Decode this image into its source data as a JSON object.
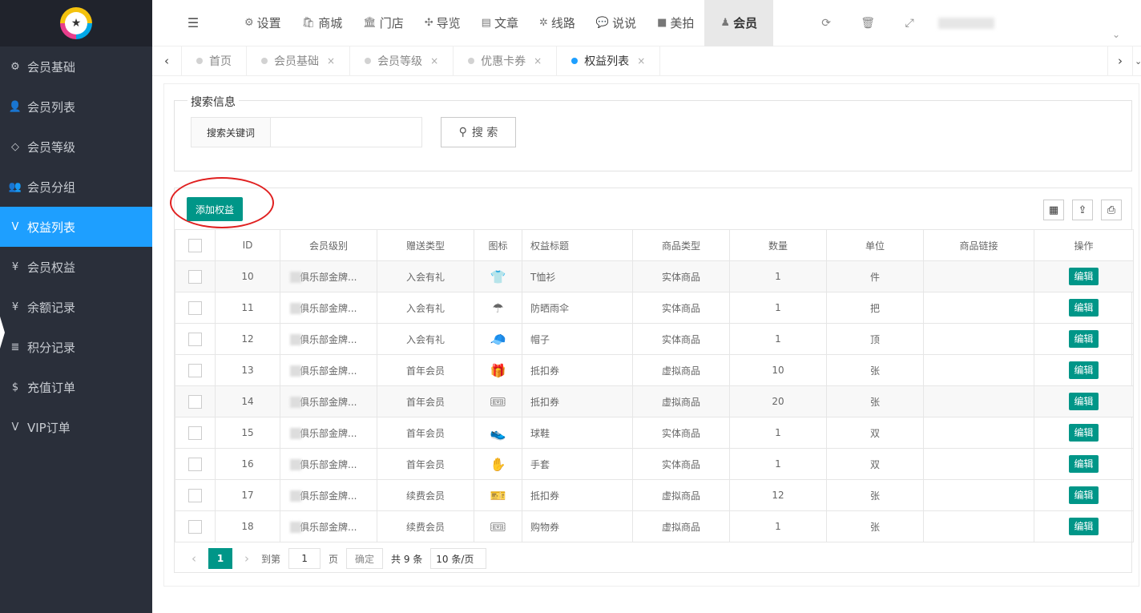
{
  "sidebar": {
    "items": [
      {
        "label": "会员基础",
        "icon": "gears-icon",
        "glyph": "⚙"
      },
      {
        "label": "会员列表",
        "icon": "user-icon",
        "glyph": "👤"
      },
      {
        "label": "会员等级",
        "icon": "diamond-icon",
        "glyph": "◇"
      },
      {
        "label": "会员分组",
        "icon": "users-icon",
        "glyph": "👥"
      },
      {
        "label": "权益列表",
        "icon": "vimeo-icon",
        "glyph": "V"
      },
      {
        "label": "会员权益",
        "icon": "yen-icon",
        "glyph": "¥"
      },
      {
        "label": "余额记录",
        "icon": "yen-icon",
        "glyph": "¥"
      },
      {
        "label": "积分记录",
        "icon": "database-icon",
        "glyph": "≣"
      },
      {
        "label": "充值订单",
        "icon": "dollar-icon",
        "glyph": "$"
      },
      {
        "label": "VIP订单",
        "icon": "vimeo-icon",
        "glyph": "V"
      }
    ],
    "active_index": 4
  },
  "topnav": {
    "items": [
      {
        "label": "设置",
        "glyph": "⚙"
      },
      {
        "label": "商城",
        "glyph": "🛍"
      },
      {
        "label": "门店",
        "glyph": "🏛"
      },
      {
        "label": "导览",
        "glyph": "✣"
      },
      {
        "label": "文章",
        "glyph": "▤"
      },
      {
        "label": "线路",
        "glyph": "✲"
      },
      {
        "label": "说说",
        "glyph": "💬"
      },
      {
        "label": "美拍",
        "glyph": "■"
      },
      {
        "label": "会员",
        "glyph": "♟"
      }
    ],
    "active_index": 8
  },
  "tabs": {
    "items": [
      {
        "label": "首页",
        "closable": false
      },
      {
        "label": "会员基础",
        "closable": true
      },
      {
        "label": "会员等级",
        "closable": true
      },
      {
        "label": "优惠卡券",
        "closable": true
      },
      {
        "label": "权益列表",
        "closable": true
      }
    ],
    "active_index": 4
  },
  "search": {
    "legend": "搜索信息",
    "keyword_label": "搜索关键词",
    "keyword_value": "",
    "button_label": "搜 索"
  },
  "toolbar": {
    "add_label": "添加权益"
  },
  "table": {
    "headers": [
      "ID",
      "会员级别",
      "赠送类型",
      "图标",
      "权益标题",
      "商品类型",
      "数量",
      "单位",
      "商品链接",
      "操作"
    ],
    "edit_label": "编辑",
    "rows": [
      {
        "id": "10",
        "level": "俱乐部金牌...",
        "gift_type": "入会有礼",
        "icon": "👕",
        "title": "T恤衫",
        "goods_type": "实体商品",
        "qty": "1",
        "unit": "件",
        "link": ""
      },
      {
        "id": "11",
        "level": "俱乐部金牌...",
        "gift_type": "入会有礼",
        "icon": "☂",
        "title": "防晒雨伞",
        "goods_type": "实体商品",
        "qty": "1",
        "unit": "把",
        "link": ""
      },
      {
        "id": "12",
        "level": "俱乐部金牌...",
        "gift_type": "入会有礼",
        "icon": "🧢",
        "title": "帽子",
        "goods_type": "实体商品",
        "qty": "1",
        "unit": "顶",
        "link": ""
      },
      {
        "id": "13",
        "level": "俱乐部金牌...",
        "gift_type": "首年会员",
        "icon": "🎁",
        "title": "抵扣券",
        "goods_type": "虚拟商品",
        "qty": "10",
        "unit": "张",
        "link": ""
      },
      {
        "id": "14",
        "level": "俱乐部金牌...",
        "gift_type": "首年会员",
        "icon": "🎟",
        "title": "抵扣券",
        "goods_type": "虚拟商品",
        "qty": "20",
        "unit": "张",
        "link": ""
      },
      {
        "id": "15",
        "level": "俱乐部金牌...",
        "gift_type": "首年会员",
        "icon": "👟",
        "title": "球鞋",
        "goods_type": "实体商品",
        "qty": "1",
        "unit": "双",
        "link": ""
      },
      {
        "id": "16",
        "level": "俱乐部金牌...",
        "gift_type": "首年会员",
        "icon": "✋",
        "title": "手套",
        "goods_type": "实体商品",
        "qty": "1",
        "unit": "双",
        "link": ""
      },
      {
        "id": "17",
        "level": "俱乐部金牌...",
        "gift_type": "续费会员",
        "icon": "🎫",
        "title": "抵扣券",
        "goods_type": "虚拟商品",
        "qty": "12",
        "unit": "张",
        "link": ""
      },
      {
        "id": "18",
        "level": "俱乐部金牌...",
        "gift_type": "续费会员",
        "icon": "🎟",
        "title": "购物券",
        "goods_type": "虚拟商品",
        "qty": "1",
        "unit": "张",
        "link": ""
      }
    ]
  },
  "pager": {
    "current": "1",
    "goto_label": "到第",
    "goto_value": "1",
    "page_label": "页",
    "confirm_label": "确定",
    "total_label": "共 9 条",
    "size_label": "10 条/页"
  },
  "colors": {
    "primary": "#009688",
    "active_blue": "#1e9fff",
    "sidebar_bg": "#2a2f3a"
  }
}
